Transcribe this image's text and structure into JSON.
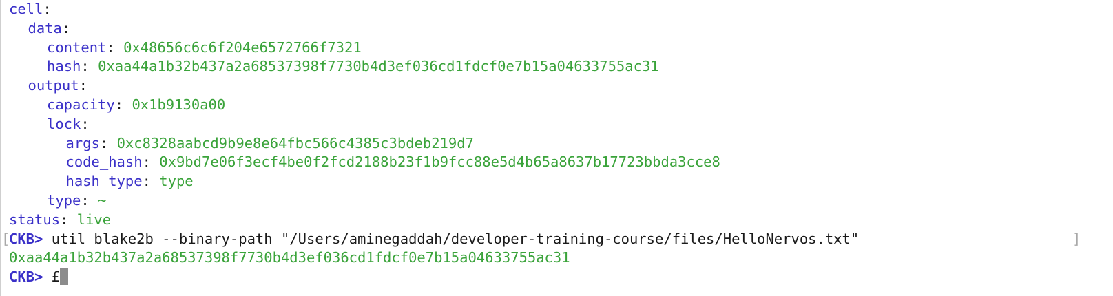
{
  "tree": {
    "cell_key": "cell",
    "data_key": "data",
    "content_key": "content",
    "content_val": "0x48656c6c6f204e6572766f7321",
    "hash_key": "hash",
    "hash_val": "0xaa44a1b32b437a2a68537398f7730b4d3ef036cd1fdcf0e7b15a04633755ac31",
    "output_key": "output",
    "capacity_key": "capacity",
    "capacity_val": "0x1b9130a00",
    "lock_key": "lock",
    "args_key": "args",
    "args_val": "0xc8328aabcd9b9e8e64fbc566c4385c3bdeb219d7",
    "code_hash_key": "code_hash",
    "code_hash_val": "0x9bd7e06f3ecf4be0f2fcd2188b23f1b9fcc88e5d4b65a8637b17723bbda3cce8",
    "hash_type_key": "hash_type",
    "hash_type_val": "type",
    "type_key": "type",
    "type_val": "~",
    "status_key": "status",
    "status_val": "live"
  },
  "session": {
    "prompt": "CKB>",
    "command": "util blake2b --binary-path \"/Users/aminegaddah/developer-training-course/files/HelloNervos.txt\"",
    "output": "0xaa44a1b32b437a2a68537398f7730b4d3ef036cd1fdcf0e7b15a04633755ac31",
    "current_input": "£"
  },
  "colors": {
    "key": "#3a30c8",
    "value": "#3aa33a",
    "text": "#1a1a1a"
  }
}
